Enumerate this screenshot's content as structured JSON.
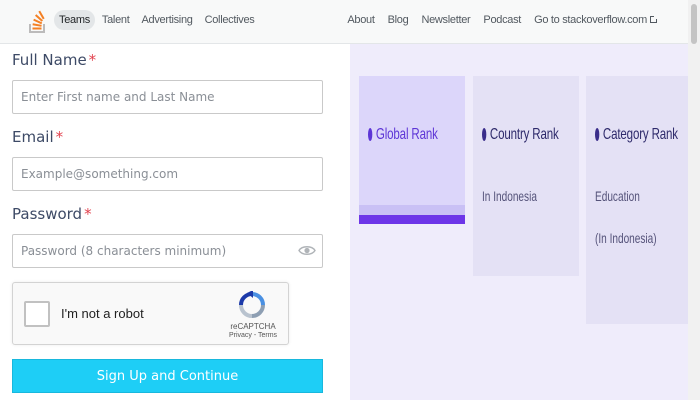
{
  "nav": {
    "left": [
      "Teams",
      "Talent",
      "Advertising",
      "Collectives"
    ],
    "right": [
      "About",
      "Blog",
      "Newsletter",
      "Podcast",
      "Go to stackoverflow.com"
    ]
  },
  "form": {
    "full_name": {
      "label": "Full Name",
      "required": "*",
      "placeholder": "Enter First name and Last Name"
    },
    "email": {
      "label": "Email",
      "required": "*",
      "placeholder": "Example@something.com"
    },
    "password": {
      "label": "Password",
      "required": "*",
      "placeholder": "Password (8 characters minimum)"
    },
    "recaptcha": {
      "text": "I'm not a robot",
      "brand": "reCAPTCHA",
      "links": "Privacy - Terms"
    },
    "submit_label": "Sign Up and Continue"
  },
  "panel": {
    "cards": [
      {
        "title": "Global Rank",
        "sub": []
      },
      {
        "title": "Country Rank",
        "sub": [
          "In Indonesia"
        ]
      },
      {
        "title": "Category Rank",
        "sub": [
          "Education",
          "(In Indonesia)"
        ]
      }
    ]
  },
  "colors": {
    "accent": "#1ecef6",
    "required": "#e2414d",
    "panel_bg": "#efecfb",
    "rank_purple": "#6d35e8"
  },
  "icons": [
    "stackoverflow-logo",
    "external-link-icon",
    "eye-icon",
    "recaptcha-logo-icon",
    "rank-dot-icon"
  ]
}
